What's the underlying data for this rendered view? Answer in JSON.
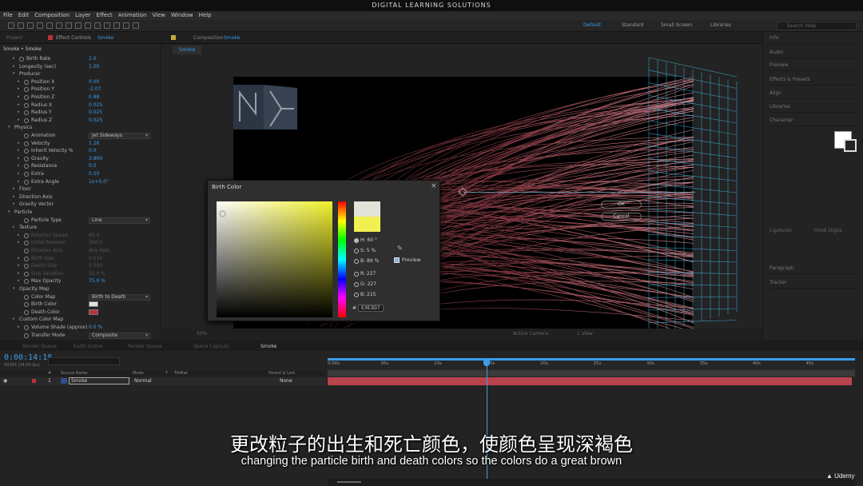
{
  "app_title": "DIGITAL LEARNING SOLUTIONS",
  "menu": [
    "File",
    "Edit",
    "Composition",
    "Layer",
    "Effect",
    "Animation",
    "View",
    "Window",
    "Help"
  ],
  "workspaces": [
    "Default",
    "Standard",
    "Small Screen",
    "Libraries"
  ],
  "search_placeholder": "Search Help",
  "left_panel": {
    "tab_project": "Project",
    "tab_effect_controls": "Effect Controls",
    "layer_name": "Smoke",
    "header": "Smoke • Smoke"
  },
  "comp_panel": {
    "tab": "Composition",
    "comp_name": "Smoke",
    "sub_tab": "Smoke",
    "bottom_zoom": "50%",
    "bottom_camera": "Active Camera",
    "bottom_view": "1 View"
  },
  "effect_rows": [
    {
      "tw": "▸",
      "label": "Birth Rate",
      "value": "2.0",
      "indent": 1,
      "stop": true
    },
    {
      "tw": "▸",
      "label": "Longevity (sec)",
      "value": "1.00",
      "indent": 1,
      "stop": false
    },
    {
      "tw": "▾",
      "label": "Producer",
      "value": "",
      "indent": 1,
      "stop": false
    },
    {
      "tw": "▸",
      "label": "Position X",
      "value": "0.00",
      "indent": 2,
      "stop": true
    },
    {
      "tw": "▸",
      "label": "Position Y",
      "value": "-2.07",
      "indent": 2,
      "stop": true
    },
    {
      "tw": "▸",
      "label": "Position Z",
      "value": "0.88",
      "indent": 2,
      "stop": true
    },
    {
      "tw": "▸",
      "label": "Radius X",
      "value": "0.025",
      "indent": 2,
      "stop": true
    },
    {
      "tw": "▸",
      "label": "Radius Y",
      "value": "0.025",
      "indent": 2,
      "stop": true
    },
    {
      "tw": "▸",
      "label": "Radius Z",
      "value": "0.025",
      "indent": 2,
      "stop": true
    },
    {
      "tw": "▾",
      "label": "Physics",
      "value": "",
      "indent": 0,
      "stop": false
    },
    {
      "tw": "",
      "label": "Animation",
      "value": "Jet Sideways",
      "indent": 2,
      "stop": true,
      "drop": true
    },
    {
      "tw": "▸",
      "label": "Velocity",
      "value": "1.26",
      "indent": 2,
      "stop": true
    },
    {
      "tw": "▸",
      "label": "Inherit Velocity %",
      "value": "0.0",
      "indent": 2,
      "stop": true
    },
    {
      "tw": "▸",
      "label": "Gravity",
      "value": "3.800",
      "indent": 2,
      "stop": true
    },
    {
      "tw": "▸",
      "label": "Resistance",
      "value": "0.0",
      "indent": 2,
      "stop": true
    },
    {
      "tw": "▸",
      "label": "Extra",
      "value": "0.50",
      "indent": 2,
      "stop": true
    },
    {
      "tw": "▸",
      "label": "Extra Angle",
      "value": "1x+0.0°",
      "indent": 2,
      "stop": true
    },
    {
      "tw": "▸",
      "label": "Floor",
      "value": "",
      "indent": 1,
      "stop": false
    },
    {
      "tw": "▸",
      "label": "Direction Axis",
      "value": "",
      "indent": 1,
      "stop": false
    },
    {
      "tw": "▸",
      "label": "Gravity Vector",
      "value": "",
      "indent": 1,
      "stop": false
    },
    {
      "tw": "▾",
      "label": "Particle",
      "value": "",
      "indent": 0,
      "stop": false
    },
    {
      "tw": "",
      "label": "Particle Type",
      "value": "Line",
      "indent": 2,
      "stop": true,
      "drop": true
    },
    {
      "tw": "▸",
      "label": "Texture",
      "value": "",
      "indent": 1,
      "stop": false
    },
    {
      "tw": "▸",
      "label": "Rotation Speed",
      "value": "60.0",
      "indent": 2,
      "stop": true,
      "dim": true
    },
    {
      "tw": "▸",
      "label": "Initial Rotation",
      "value": "360.0",
      "indent": 2,
      "stop": true,
      "dim": true
    },
    {
      "tw": "",
      "label": "Rotation Axis",
      "value": "Any Axis",
      "indent": 2,
      "stop": true,
      "dim": true
    },
    {
      "tw": "▸",
      "label": "Birth Size",
      "value": "0.510",
      "indent": 2,
      "stop": true,
      "dim": true
    },
    {
      "tw": "▸",
      "label": "Death Size",
      "value": "0.500",
      "indent": 2,
      "stop": true,
      "dim": true
    },
    {
      "tw": "▸",
      "label": "Size Variation",
      "value": "50.0 %",
      "indent": 2,
      "stop": true,
      "dim": true
    },
    {
      "tw": "▸",
      "label": "Max Opacity",
      "value": "75.0 %",
      "indent": 2,
      "stop": true
    },
    {
      "tw": "▾",
      "label": "Opacity Map",
      "value": "",
      "indent": 1,
      "stop": false
    },
    {
      "tw": "",
      "label": "Color Map",
      "value": "Birth to Death",
      "indent": 2,
      "stop": true,
      "drop": true
    },
    {
      "tw": "",
      "label": "Birth Color",
      "value": "",
      "indent": 2,
      "stop": true,
      "swatch": "#e3e3d7"
    },
    {
      "tw": "",
      "label": "Death Color",
      "value": "",
      "indent": 2,
      "stop": true,
      "swatch": "#b8333c"
    },
    {
      "tw": "▸",
      "label": "Custom Color Map",
      "value": "",
      "indent": 1,
      "stop": false
    },
    {
      "tw": "▸",
      "label": "Volume Shade (approx)",
      "value": "0.0 %",
      "indent": 2,
      "stop": true
    },
    {
      "tw": "",
      "label": "Transfer Mode",
      "value": "Composite",
      "indent": 2,
      "stop": true,
      "drop": true
    }
  ],
  "color_picker": {
    "title": "Birth Color",
    "ok": "OK",
    "cancel": "Cancel",
    "h": "60 °",
    "s": "5 %",
    "b": "89 %",
    "r": "227",
    "g": "227",
    "bl": "215",
    "hex": "E3E3D7",
    "preview": "Preview",
    "new_color": "#e3e3d7",
    "old_color": "#f0f050"
  },
  "right_panel": [
    "Info",
    "Audio",
    "Preview",
    "Effects & Presets",
    "Align",
    "Libraries",
    "Character",
    "Paragraph",
    "Tracker"
  ],
  "right_panel_sub": [
    "Ligatures",
    "Hindi Digits"
  ],
  "timeline": {
    "tabs": [
      "Render Queue",
      "Earth Scene",
      "Render Queue",
      "Space Capsule",
      "Smoke"
    ],
    "timecode": "0:00:14:18",
    "timecode_sub": "00354 (24.00 fps)",
    "ruler": [
      "0:00s",
      "05s",
      "10s",
      "15s",
      "20s",
      "25s",
      "30s",
      "35s",
      "40s",
      "45s"
    ],
    "col_headers": [
      "#",
      "Source Name",
      "Mode",
      "T",
      "TrkMat",
      "Parent & Link"
    ],
    "layer_index": "1",
    "layer_name": "Smoke",
    "layer_mode": "Normal",
    "layer_parent": "None"
  },
  "subtitle_cn": "更改粒子的出生和死亡颜色，使颜色呈现深褐色",
  "subtitle_en": "changing the particle birth and death colors so the colors do a great brown",
  "brand": "Udemy"
}
